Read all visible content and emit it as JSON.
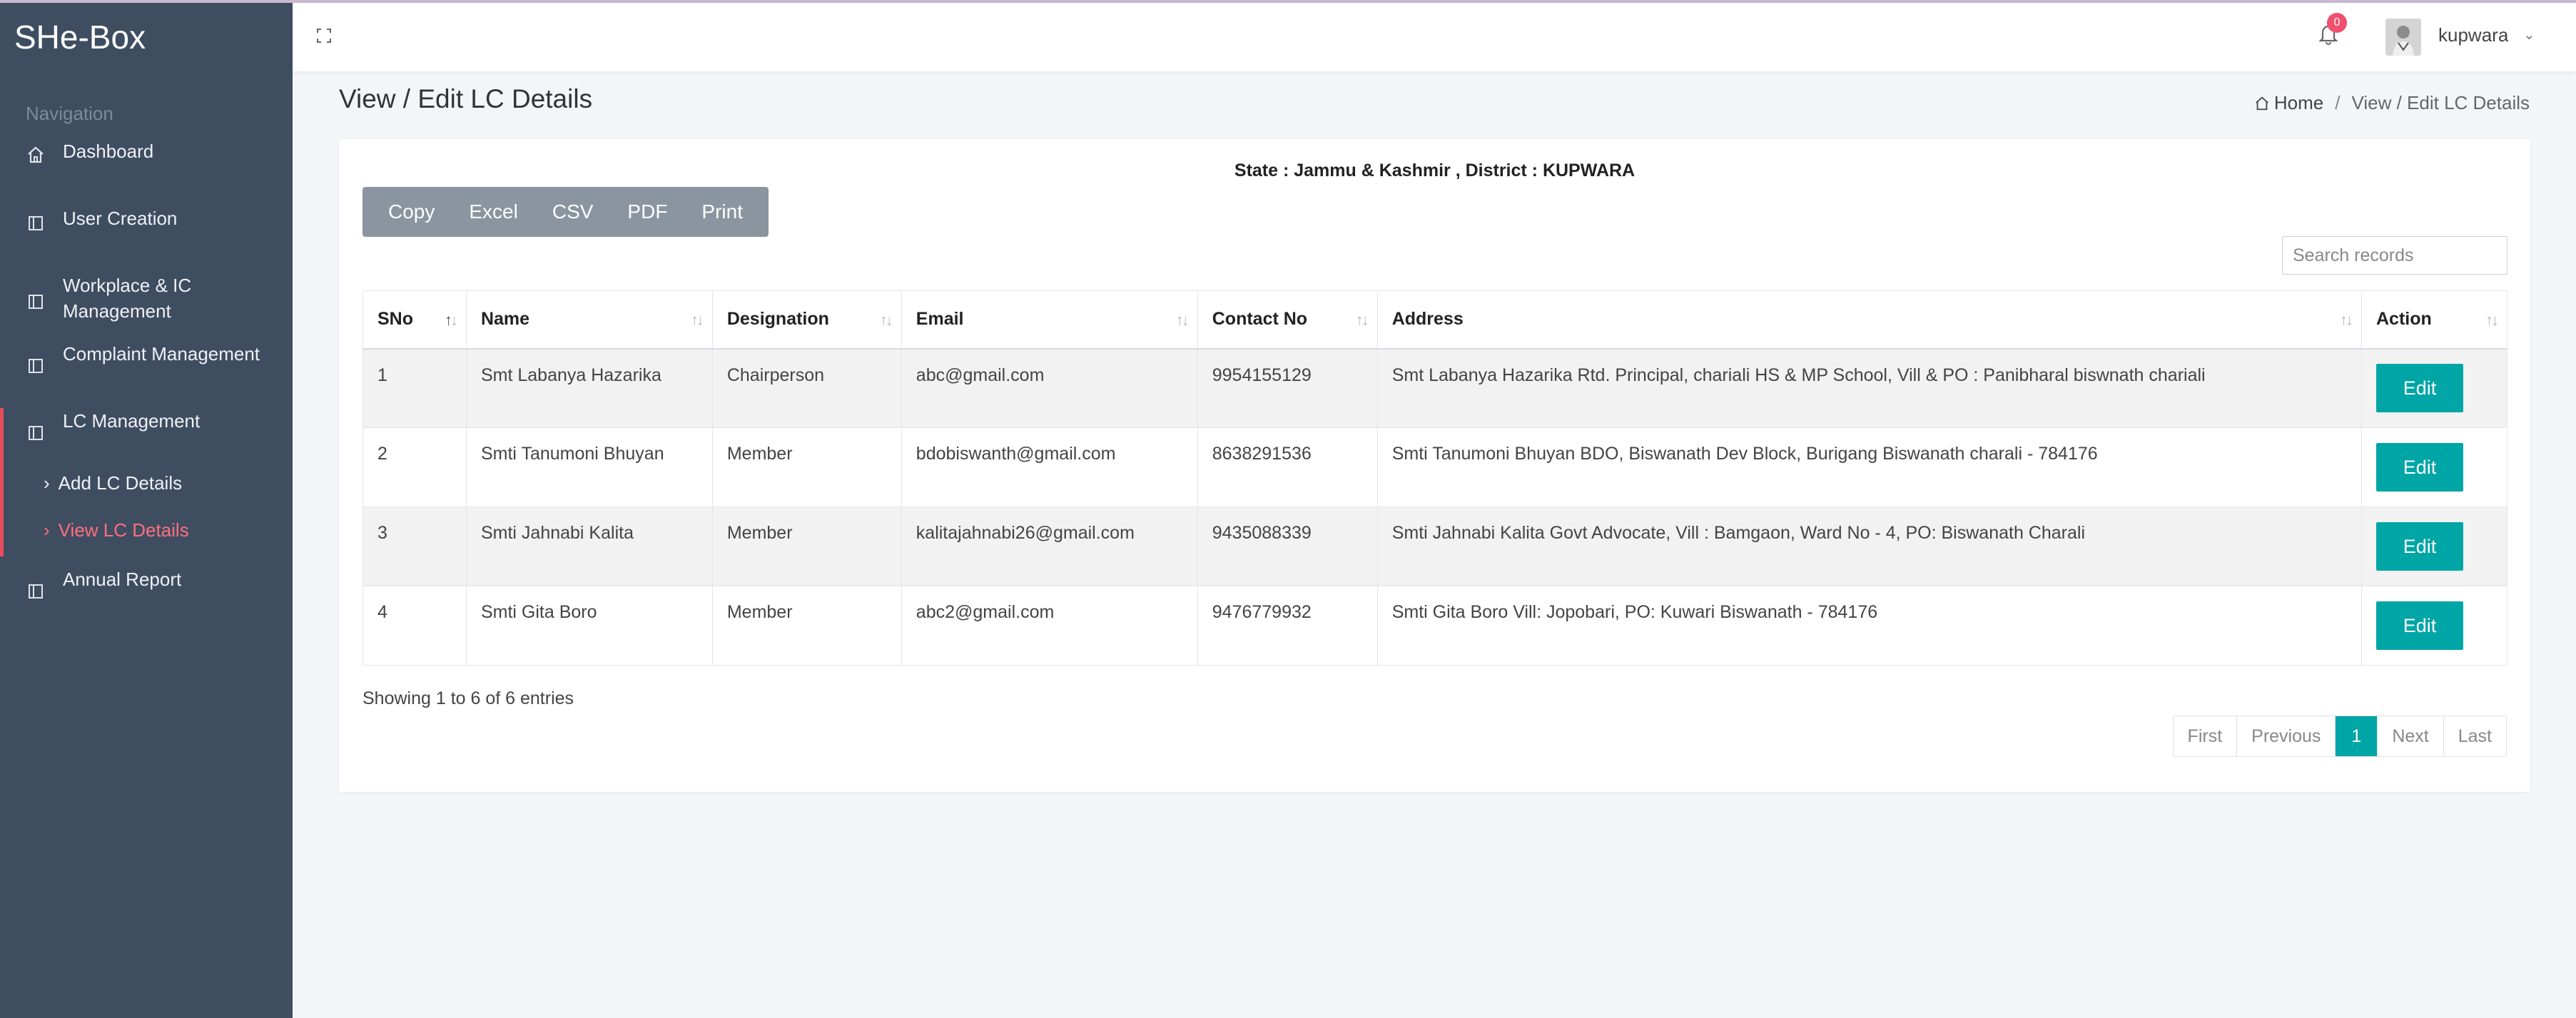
{
  "app": {
    "brand": "SHe-Box"
  },
  "sidebar": {
    "heading": "Navigation",
    "items": [
      {
        "label": "Dashboard",
        "icon": "home-icon"
      },
      {
        "label": "User Creation",
        "icon": "panel-icon"
      },
      {
        "label": "Workplace & IC Management",
        "icon": "panel-icon"
      },
      {
        "label": "Complaint Management",
        "icon": "panel-icon"
      },
      {
        "label": "LC Management",
        "icon": "panel-icon",
        "subitems": [
          {
            "label": "Add LC Details",
            "active": false
          },
          {
            "label": "View LC Details",
            "active": true
          }
        ]
      },
      {
        "label": "Annual Report",
        "icon": "panel-icon"
      }
    ]
  },
  "topbar": {
    "notification_count": "0",
    "username": "kupwara"
  },
  "page": {
    "title": "View / Edit LC Details",
    "breadcrumb": {
      "home": "Home",
      "current": "View / Edit LC Details"
    }
  },
  "card": {
    "state_line": "State : Jammu & Kashmir , District : KUPWARA",
    "export_buttons": [
      "Copy",
      "Excel",
      "CSV",
      "PDF",
      "Print"
    ],
    "search_placeholder": "Search records",
    "columns": [
      "SNo",
      "Name",
      "Designation",
      "Email",
      "Contact No",
      "Address",
      "Action"
    ],
    "rows": [
      {
        "sno": "1",
        "name": "Smt Labanya Hazarika",
        "designation": "Chairperson",
        "email": "abc@gmail.com",
        "contact": "9954155129",
        "address": "Smt Labanya Hazarika Rtd. Principal, chariali HS & MP School, Vill & PO : Panibharal biswnath chariali",
        "action": "Edit"
      },
      {
        "sno": "2",
        "name": "Smti Tanumoni Bhuyan",
        "designation": "Member",
        "email": "bdobiswanth@gmail.com",
        "contact": "8638291536",
        "address": "Smti Tanumoni Bhuyan BDO, Biswanath Dev Block, Burigang Biswanath charali - 784176",
        "action": "Edit"
      },
      {
        "sno": "3",
        "name": "Smti Jahnabi Kalita",
        "designation": "Member",
        "email": "kalitajahnabi26@gmail.com",
        "contact": "9435088339",
        "address": "Smti Jahnabi Kalita Govt Advocate, Vill : Bamgaon, Ward No - 4, PO: Biswanath Charali",
        "action": "Edit"
      },
      {
        "sno": "4",
        "name": "Smti Gita Boro",
        "designation": "Member",
        "email": "abc2@gmail.com",
        "contact": "9476779932",
        "address": "Smti Gita Boro Vill: Jopobari, PO: Kuwari Biswanath - 784176",
        "action": "Edit"
      }
    ],
    "info": "Showing 1 to 6 of 6 entries",
    "pagination": {
      "first": "First",
      "previous": "Previous",
      "current": "1",
      "next": "Next",
      "last": "Last"
    }
  },
  "colors": {
    "sidebar": "#3f4d61",
    "accent": "#00a5a6",
    "active_nav": "#ff6f7e",
    "badge": "#f0506e"
  }
}
